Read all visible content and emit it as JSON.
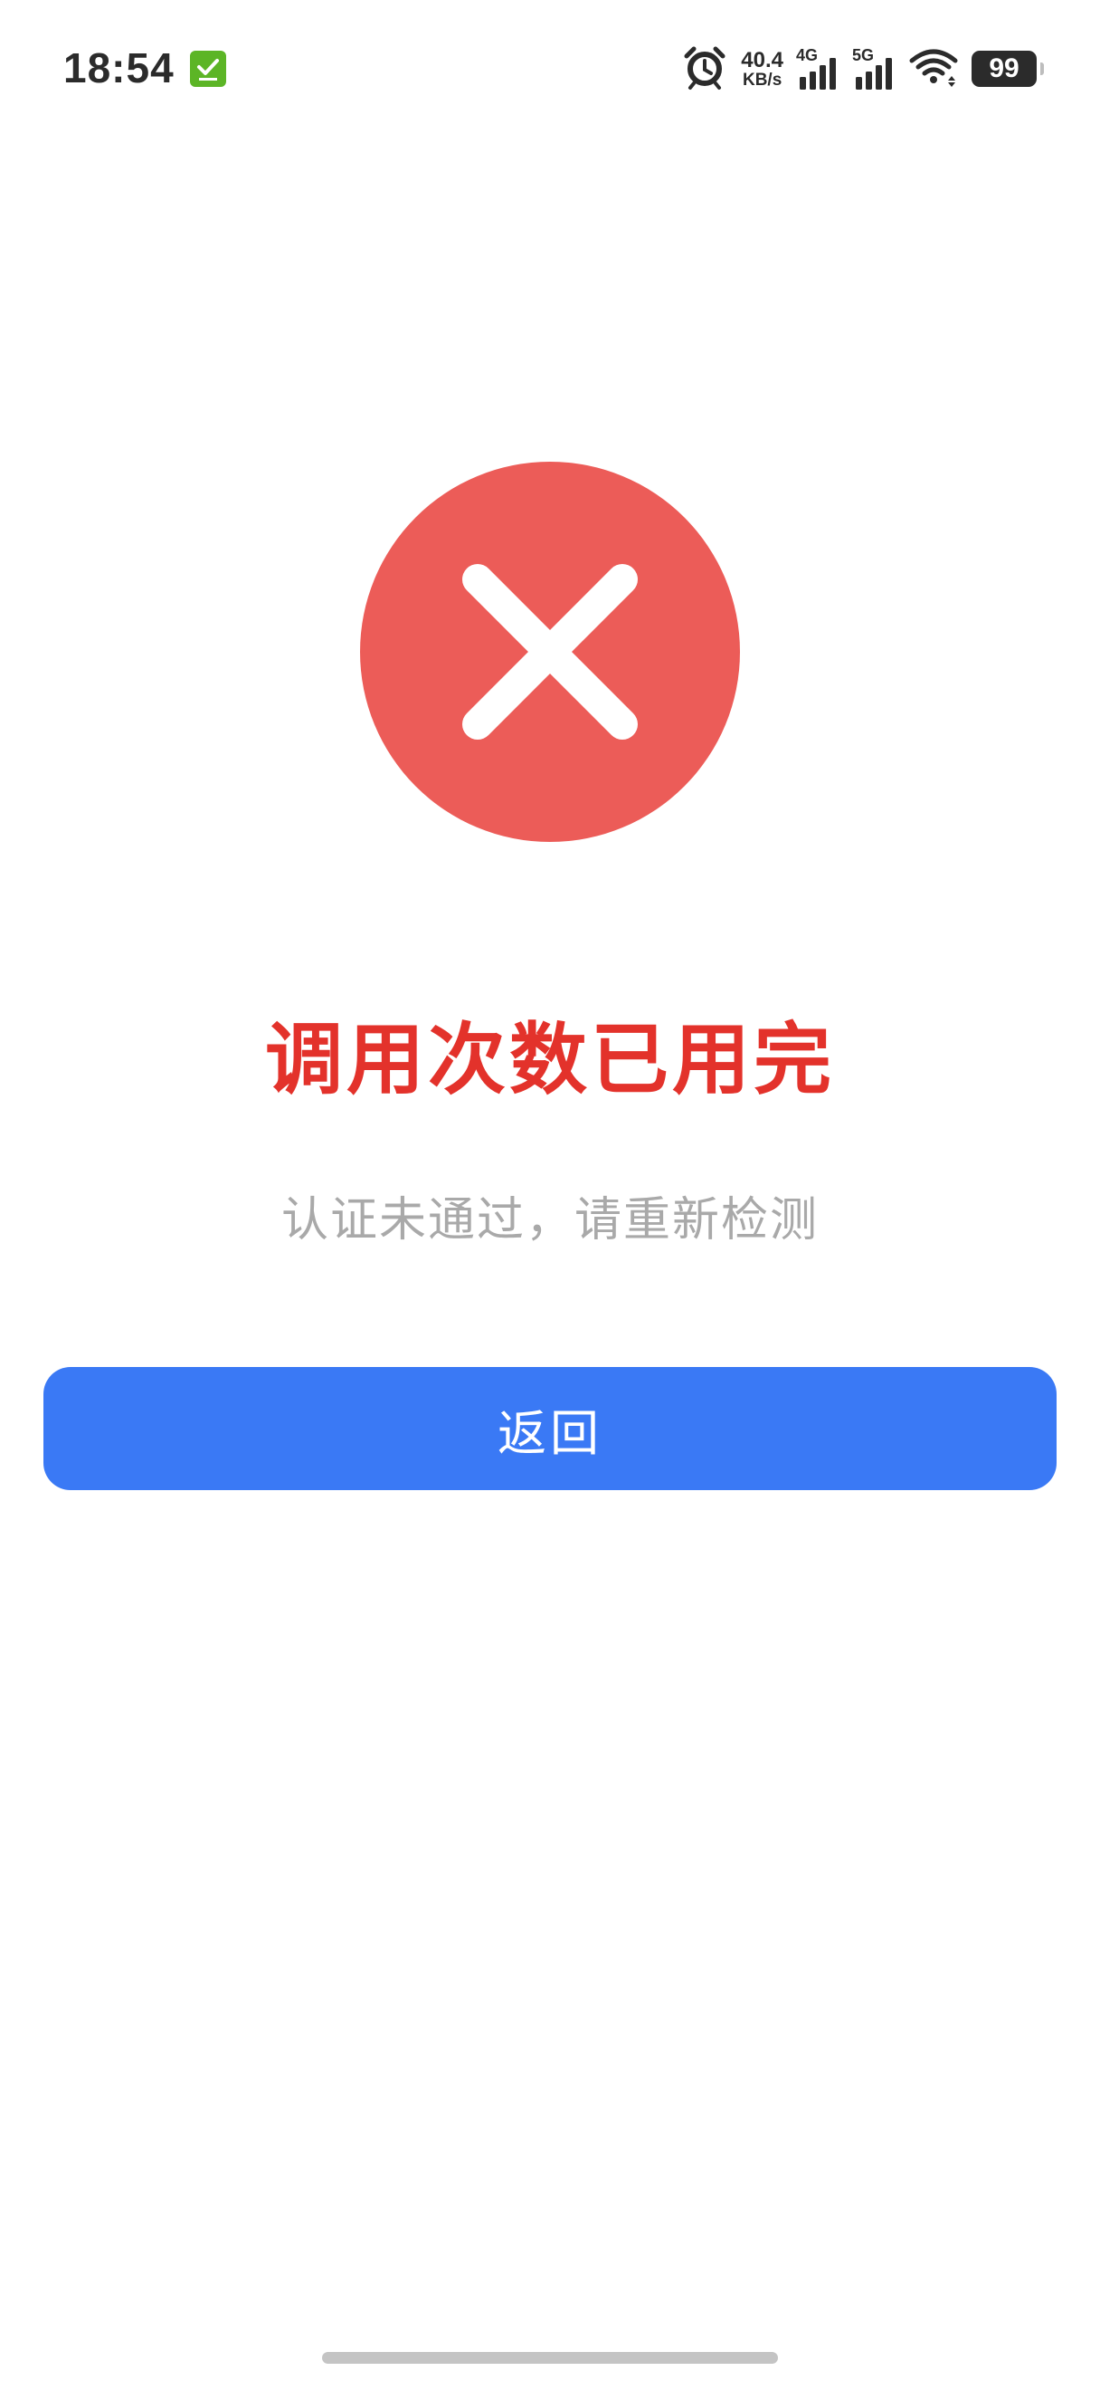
{
  "status_bar": {
    "time": "18:54",
    "net_speed_value": "40.4",
    "net_speed_unit": "KB/s",
    "signal_1_label": "4G",
    "signal_2_label": "5G",
    "battery": "99",
    "icons": [
      "app-notification-icon",
      "alarm-icon",
      "signal-4g-icon",
      "signal-5g-icon",
      "wifi-icon",
      "battery-icon"
    ]
  },
  "result": {
    "icon": "error-x-icon",
    "title": "调用次数已用完",
    "subtitle": "认证未通过，请重新检测",
    "back_label": "返回"
  },
  "colors": {
    "error": "#ec5c58",
    "title": "#e3322b",
    "subtitle": "#a9a9a9",
    "button": "#3a79f5",
    "notification": "#5cb526"
  }
}
